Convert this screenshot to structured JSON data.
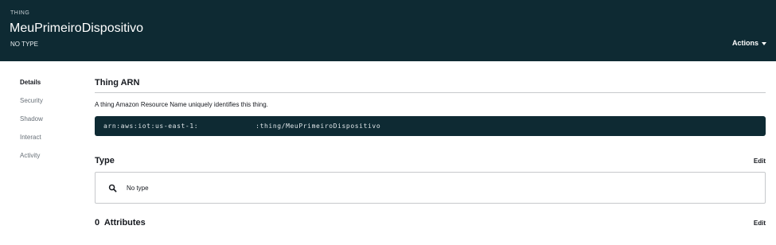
{
  "header": {
    "eyebrow": "THING",
    "title": "MeuPrimeiroDispositivo",
    "subtitle": "NO TYPE",
    "actions_label": "Actions"
  },
  "nav": {
    "items": [
      {
        "label": "Details",
        "active": true
      },
      {
        "label": "Security",
        "active": false
      },
      {
        "label": "Shadow",
        "active": false
      },
      {
        "label": "Interact",
        "active": false
      },
      {
        "label": "Activity",
        "active": false
      }
    ]
  },
  "arn": {
    "title": "Thing ARN",
    "description": "A thing Amazon Resource Name uniquely identifies this thing.",
    "value_prefix": "arn:aws:iot:us-east-1:",
    "value_suffix": ":thing/MeuPrimeiroDispositivo"
  },
  "type": {
    "title": "Type",
    "edit_label": "Edit",
    "value": "No type"
  },
  "attributes": {
    "count": "0",
    "title": "Attributes",
    "edit_label": "Edit"
  },
  "colors": {
    "header_bg": "#0e2a33",
    "arn_box_bg": "#0e2a33"
  }
}
